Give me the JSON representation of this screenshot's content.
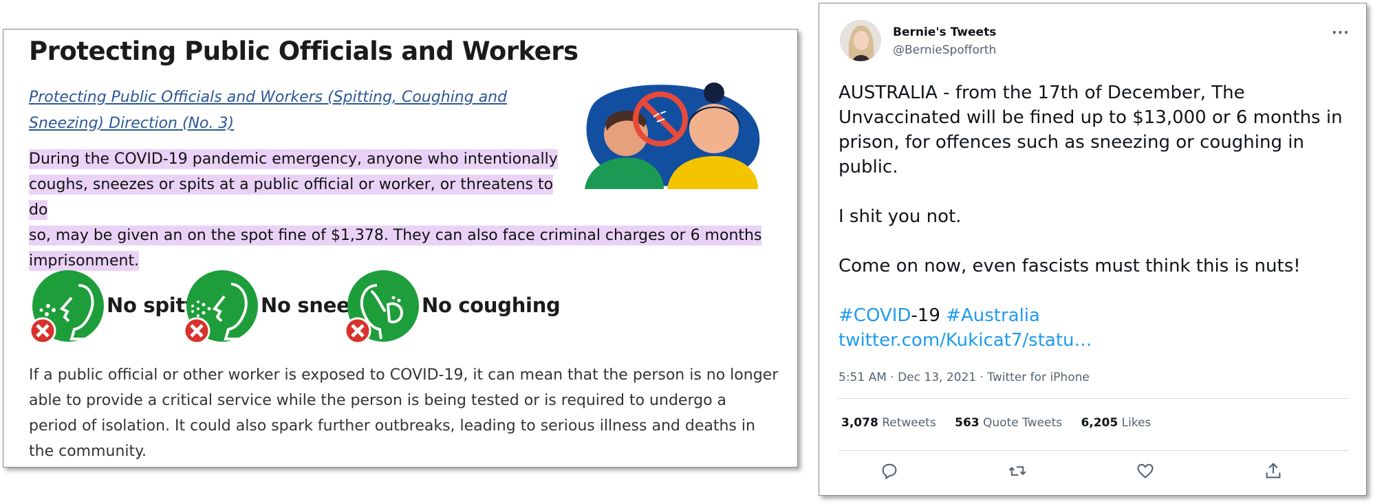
{
  "left": {
    "title": "Protecting Public Officials and Workers",
    "direction_link": "Protecting Public Officials and Workers (Spitting, Coughing and Sneezing) Direction (No. 3)",
    "highlight_line1": "During the COVID-19 pandemic emergency, anyone who intentionally coughs, sneezes or spits at a public official or worker, or threatens to do",
    "highlight_line2": "so, may be given an on the spot fine of $1,378. They can also face criminal charges or 6 months imprisonment.",
    "rules": [
      {
        "label": "No spitting",
        "icon": "no-spitting-icon"
      },
      {
        "label": "No sneezing",
        "icon": "no-sneezing-icon"
      },
      {
        "label": "No coughing",
        "icon": "no-coughing-icon"
      }
    ],
    "body": "If a public official or other worker is exposed to COVID-19, it can mean that the person is no longer able to provide a critical service while the person is being tested or is required to undergo a period of isolation. It could also spark further outbreaks, leading to serious illness and deaths in the community.",
    "colors": {
      "link": "#2b5797",
      "highlight": "#ead2f7",
      "icon_green": "#1e9e3a",
      "x_red": "#d9312b"
    }
  },
  "tweet": {
    "display_name": "Bernie's Tweets",
    "handle": "@BernieSpofforth",
    "more_icon": "more-dots-icon",
    "paragraph1": "AUSTRALIA - from the 17th of December, The Unvaccinated will be fined up to $13,000 or 6 months in prison, for offences such as sneezing or coughing in public.",
    "paragraph2": "I shit you not.",
    "paragraph3": "Come on now, even fascists must think this is nuts!",
    "hashtag1": "#COVID",
    "hashtag1_suffix": "-19",
    "hashtag2": "#Australia",
    "link": "twitter.com/Kukicat7/statu…",
    "timestamp": "5:51 AM · Dec 13, 2021 · Twitter for iPhone",
    "stats": {
      "retweets_count": "3,078",
      "retweets_label": "Retweets",
      "quotes_count": "563",
      "quotes_label": "Quote Tweets",
      "likes_count": "6,205",
      "likes_label": "Likes"
    },
    "actions": [
      "reply-icon",
      "retweet-icon",
      "like-icon",
      "share-icon"
    ],
    "colors": {
      "accent": "#1d9bf0",
      "muted": "#536471"
    }
  }
}
